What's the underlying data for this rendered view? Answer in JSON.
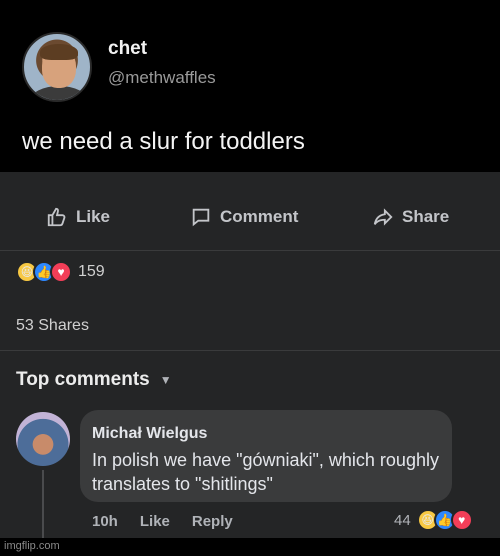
{
  "tweet": {
    "display_name": "chet",
    "handle": "@methwaffles",
    "text": "we need a slur for toddlers"
  },
  "post_actions": {
    "like": "Like",
    "comment": "Comment",
    "share": "Share"
  },
  "reactions": {
    "count": "159",
    "icons": [
      "haha-reaction-icon",
      "like-reaction-icon",
      "love-reaction-icon"
    ]
  },
  "shares": "53 Shares",
  "top_comments": "Top comments",
  "comment": {
    "author": "Michał Wielgus",
    "text": "In polish we have \"gówniaki\", which roughly translates to \"shitlings\"",
    "time": "10h",
    "like": "Like",
    "reply": "Reply",
    "reaction_count": "44"
  },
  "watermark": "imgflip.com",
  "colors": {
    "background": "#000000",
    "card": "#242526",
    "bubble": "#3a3b3c",
    "like_blue": "#2d88ff",
    "love_red": "#f33e58",
    "haha_yellow": "#f7c843"
  }
}
